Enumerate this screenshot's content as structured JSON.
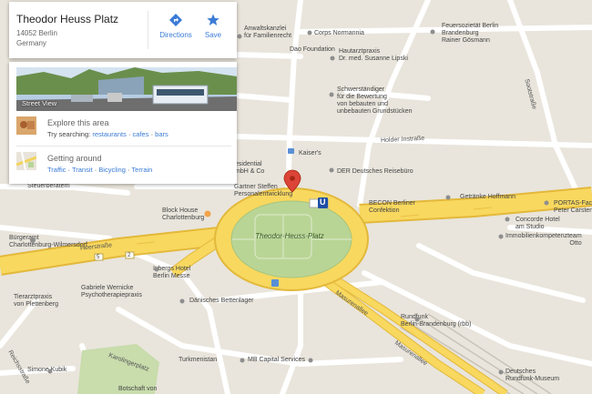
{
  "place": {
    "name": "Theodor Heuss Platz",
    "address_line1": "14052 Berlin",
    "address_line2": "Germany",
    "directions_label": "Directions",
    "save_label": "Save"
  },
  "explore": {
    "street_view_label": "Street View",
    "explore_title": "Explore this area",
    "try_searching_label": "Try searching:",
    "search_links": [
      "restaurants",
      "cafes",
      "bars"
    ],
    "getting_around_title": "Getting around",
    "transport_links": [
      "Traffic",
      "Transit",
      "Bicycling",
      "Terrain"
    ]
  },
  "map": {
    "square_label": "Theodor-Heuss-Platz",
    "streets": {
      "heerstrasse": "Heerstraße",
      "holder": "Holder Instraße",
      "masurenallee_1": "Masurenallee",
      "masurenallee_2": "Masurenallee",
      "sootstrasse": "Sootstraße",
      "karolingerplatz": "Karolingerplatz",
      "reichsstrasse": "Reichsstraße"
    },
    "pois": {
      "anwaltskanzlei": "Anwaltskanzlei\nfür Familienrecht",
      "corps": "Corps Normannia",
      "dao": "Dao Foundation",
      "hautarzt": "Hautarztpraxis\nDr. med. Susanne Lipski",
      "feuer": "Feuersozietät Berlin\nBrandenburg\nRainer Gösmann",
      "schwer": "Schwerständiger\nfür die Bewertung\nvon bebauten und\nunbebauten Grundstücken",
      "kaisers": "Kaiser's",
      "residential": "esidential\nmbH & Co",
      "gartner": "Gartner Steffen\nPersonalentwicklung",
      "dfr": "DER Deutsches Reisebüro",
      "becon": "BECON Berliner\nConfektion",
      "getraenke": "Getränke Hoffmann",
      "portas": "PORTAS-Fach\nPeter Carsten",
      "concorde": "Concorde Hotel\nam Studio",
      "immobilien": "Immobilienkompetenzteam\nOtto",
      "steuer": "Steuerberatern",
      "blockhouse": "Block House\nCharlottenburg",
      "buergeramt": "Bürgeramt\nCharlottenburg-Wilmersdorf",
      "ivbergs": "Ivbergs Hotel\nBerlin Messe",
      "wernicke": "Gabriele Wernicke\nPsychotherapiepraxis",
      "tierarzt": "Tierarztpraxis\nvon Plettenberg",
      "baettenlager": "Dänisches Bettenlager",
      "rundfunk": "Rundfunk\nBerlin-Brandenburg (rbb)",
      "turkmenistan": "Turkmenistan",
      "mbcapital": "MB Capital Services",
      "simone": "Simone Kubik",
      "museum": "Deutsches\nRundfunk-Museum",
      "dotschaft": "Botschaft von"
    },
    "route_numbers": [
      "5",
      "2"
    ],
    "u_bahn": "U"
  },
  "colors": {
    "map_bg": "#e9e5dc",
    "road_yellow": "#f8d85f",
    "road_border": "#e3b83a",
    "park_green": "#b9d596",
    "link_blue": "#3a7bd5",
    "marker_red": "#db4437"
  }
}
